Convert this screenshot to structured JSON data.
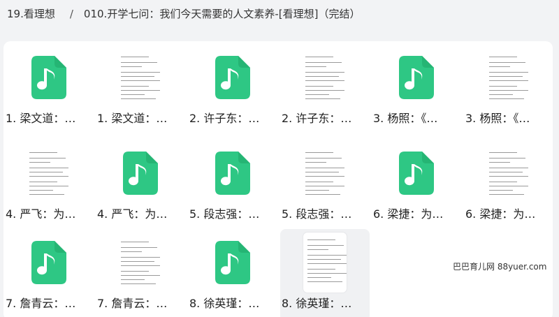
{
  "breadcrumb": {
    "parent": "19.看理想",
    "separator": "/",
    "current": "010.开学七问：我们今天需要的人文素养-[看理想]（完结）"
  },
  "colors": {
    "audio_icon": "#2ec784",
    "audio_glyph": "#ffffff",
    "hover_bg": "#f0f1f3"
  },
  "files": [
    {
      "name": "1. 梁文道：…",
      "type": "audio",
      "icon": "music-note-file-icon"
    },
    {
      "name": "1. 梁文道：…",
      "type": "document"
    },
    {
      "name": "2. 许子东：…",
      "type": "audio",
      "icon": "music-note-file-icon"
    },
    {
      "name": "2. 许子东：…",
      "type": "document"
    },
    {
      "name": "3. 杨照：《…",
      "type": "audio",
      "icon": "music-note-file-icon"
    },
    {
      "name": "3. 杨照：《…",
      "type": "document"
    },
    {
      "name": "4. 严飞：为…",
      "type": "document"
    },
    {
      "name": "4. 严飞：为…",
      "type": "audio",
      "icon": "music-note-file-icon"
    },
    {
      "name": "5. 段志强：…",
      "type": "audio",
      "icon": "music-note-file-icon"
    },
    {
      "name": "5. 段志强：…",
      "type": "document"
    },
    {
      "name": "6. 梁捷：为…",
      "type": "audio",
      "icon": "music-note-file-icon"
    },
    {
      "name": "6. 梁捷：为…",
      "type": "document"
    },
    {
      "name": "7. 詹青云：…",
      "type": "audio",
      "icon": "music-note-file-icon"
    },
    {
      "name": "7. 詹青云：…",
      "type": "document"
    },
    {
      "name": "8. 徐英瑾：…",
      "type": "audio",
      "icon": "music-note-file-icon"
    },
    {
      "name": "8. 徐英瑾：…",
      "type": "document",
      "hovered": true
    }
  ],
  "watermark": "巴巴育儿网 88yuer.com"
}
